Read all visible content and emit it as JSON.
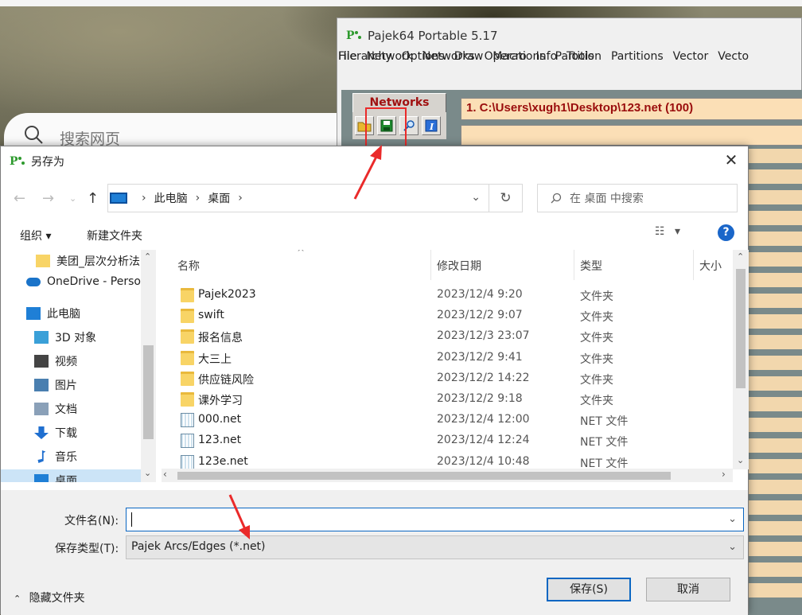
{
  "background": {
    "search_placeholder": "搜索网页"
  },
  "pajek": {
    "title": "Pajek64 Portable 5.17",
    "menu_row1": [
      "File",
      "Network",
      "Networks",
      "Operations",
      "Partition",
      "Partitions",
      "Vector",
      "Vecto"
    ],
    "menu_row2": [
      "Hierarchy",
      "Options",
      "Draw",
      "Macro",
      "Info",
      "Tools"
    ],
    "networks_tab": "Networks",
    "network_field": "1. C:\\Users\\xugh1\\Desktop\\123.net (100)",
    "tool_icons": [
      "open-folder-icon",
      "save-disk-icon",
      "magnifier-icon",
      "info-icon"
    ]
  },
  "dialog": {
    "title": "另存为",
    "breadcrumb": [
      "此电脑",
      "桌面"
    ],
    "search_placeholder": "在 桌面 中搜索",
    "toolbar": {
      "organize": "组织 ▾",
      "new_folder": "新建文件夹",
      "view_menu": "▾",
      "help": "?"
    },
    "sidebar": [
      {
        "label": "美团_层次分析法",
        "icon": "folder-icon"
      },
      {
        "label": "OneDrive - Personal",
        "icon": "cloud-icon"
      },
      {
        "label": "此电脑",
        "icon": "pc-icon"
      },
      {
        "label": "3D 对象",
        "icon": "3d-objects-icon"
      },
      {
        "label": "视频",
        "icon": "video-icon"
      },
      {
        "label": "图片",
        "icon": "picture-icon"
      },
      {
        "label": "文档",
        "icon": "document-icon"
      },
      {
        "label": "下载",
        "icon": "download-icon"
      },
      {
        "label": "音乐",
        "icon": "music-icon"
      },
      {
        "label": "桌面",
        "icon": "desktop-icon"
      }
    ],
    "columns": {
      "name": "名称",
      "modified": "修改日期",
      "type": "类型",
      "size": "大小"
    },
    "files": [
      {
        "name": "Pajek2023",
        "modified": "2023/12/4 9:20",
        "type": "文件夹",
        "kind": "folder"
      },
      {
        "name": "swift",
        "modified": "2023/12/2 9:07",
        "type": "文件夹",
        "kind": "folder"
      },
      {
        "name": "报名信息",
        "modified": "2023/12/3 23:07",
        "type": "文件夹",
        "kind": "folder"
      },
      {
        "name": "大三上",
        "modified": "2023/12/2 9:41",
        "type": "文件夹",
        "kind": "folder"
      },
      {
        "name": "供应链风险",
        "modified": "2023/12/2 14:22",
        "type": "文件夹",
        "kind": "folder"
      },
      {
        "name": "课外学习",
        "modified": "2023/12/2 9:18",
        "type": "文件夹",
        "kind": "folder"
      },
      {
        "name": "000.net",
        "modified": "2023/12/4 12:00",
        "type": "NET 文件",
        "kind": "file"
      },
      {
        "name": "123.net",
        "modified": "2023/12/4 12:24",
        "type": "NET 文件",
        "kind": "file"
      },
      {
        "name": "123e.net",
        "modified": "2023/12/4 10:48",
        "type": "NET 文件",
        "kind": "file"
      }
    ],
    "filename_label": "文件名(N):",
    "filename_value": "",
    "filetype_label": "保存类型(T):",
    "filetype_value": "Pajek Arcs/Edges (*.net)",
    "hide_folders": "隐藏文件夹",
    "save_button": "保存(S)",
    "cancel_button": "取消"
  },
  "colors": {
    "accent": "#0a66c2",
    "annotation_red": "#ea2a2a",
    "pajek_field": "#fbdfb6",
    "pajek_field_text": "#9a0d0d"
  }
}
